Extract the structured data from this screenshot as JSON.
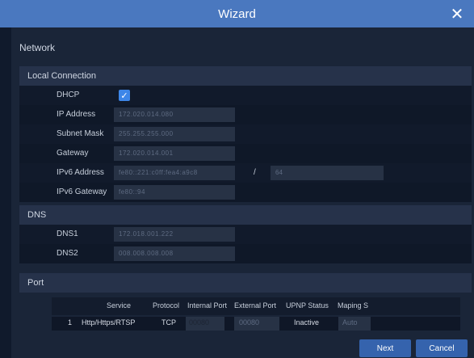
{
  "window": {
    "title": "Wizard",
    "close_icon": "close-icon"
  },
  "section": {
    "title": "Network"
  },
  "local_connection": {
    "header": "Local Connection",
    "dhcp_label": "DHCP",
    "dhcp_checked": true,
    "ip_label": "IP Address",
    "ip_value": "172.020.014.080",
    "subnet_label": "Subnet Mask",
    "subnet_value": "255.255.255.000",
    "gateway_label": "Gateway",
    "gateway_value": "172.020.014.001",
    "ipv6_label": "IPv6 Address",
    "ipv6_value": "fe80::221:c0ff:fea4:a9c8",
    "ipv6_prefix_sep": "/",
    "ipv6_prefix_value": "64",
    "ipv6_gateway_label": "IPv6 Gateway",
    "ipv6_gateway_value": "fe80::94"
  },
  "dns": {
    "header": "DNS",
    "dns1_label": "DNS1",
    "dns1_value": "172.018.001.222",
    "dns2_label": "DNS2",
    "dns2_value": "008.008.008.008"
  },
  "port": {
    "header": "Port",
    "columns": [
      "Service",
      "Protocol",
      "Internal Port",
      "External Port",
      "UPNP Status",
      "Maping S"
    ],
    "rows": [
      {
        "index": "1",
        "service": "Http/Https/RTSP",
        "protocol": "TCP",
        "internal_port": "00080",
        "external_port": "00080",
        "upnp_status": "Inactive",
        "maping": "Auto"
      }
    ]
  },
  "footer": {
    "next_label": "Next",
    "cancel_label": "Cancel"
  },
  "colors": {
    "titlebar": "#4a78bf",
    "accent": "#3563ad",
    "checkbox": "#3d86e8"
  }
}
